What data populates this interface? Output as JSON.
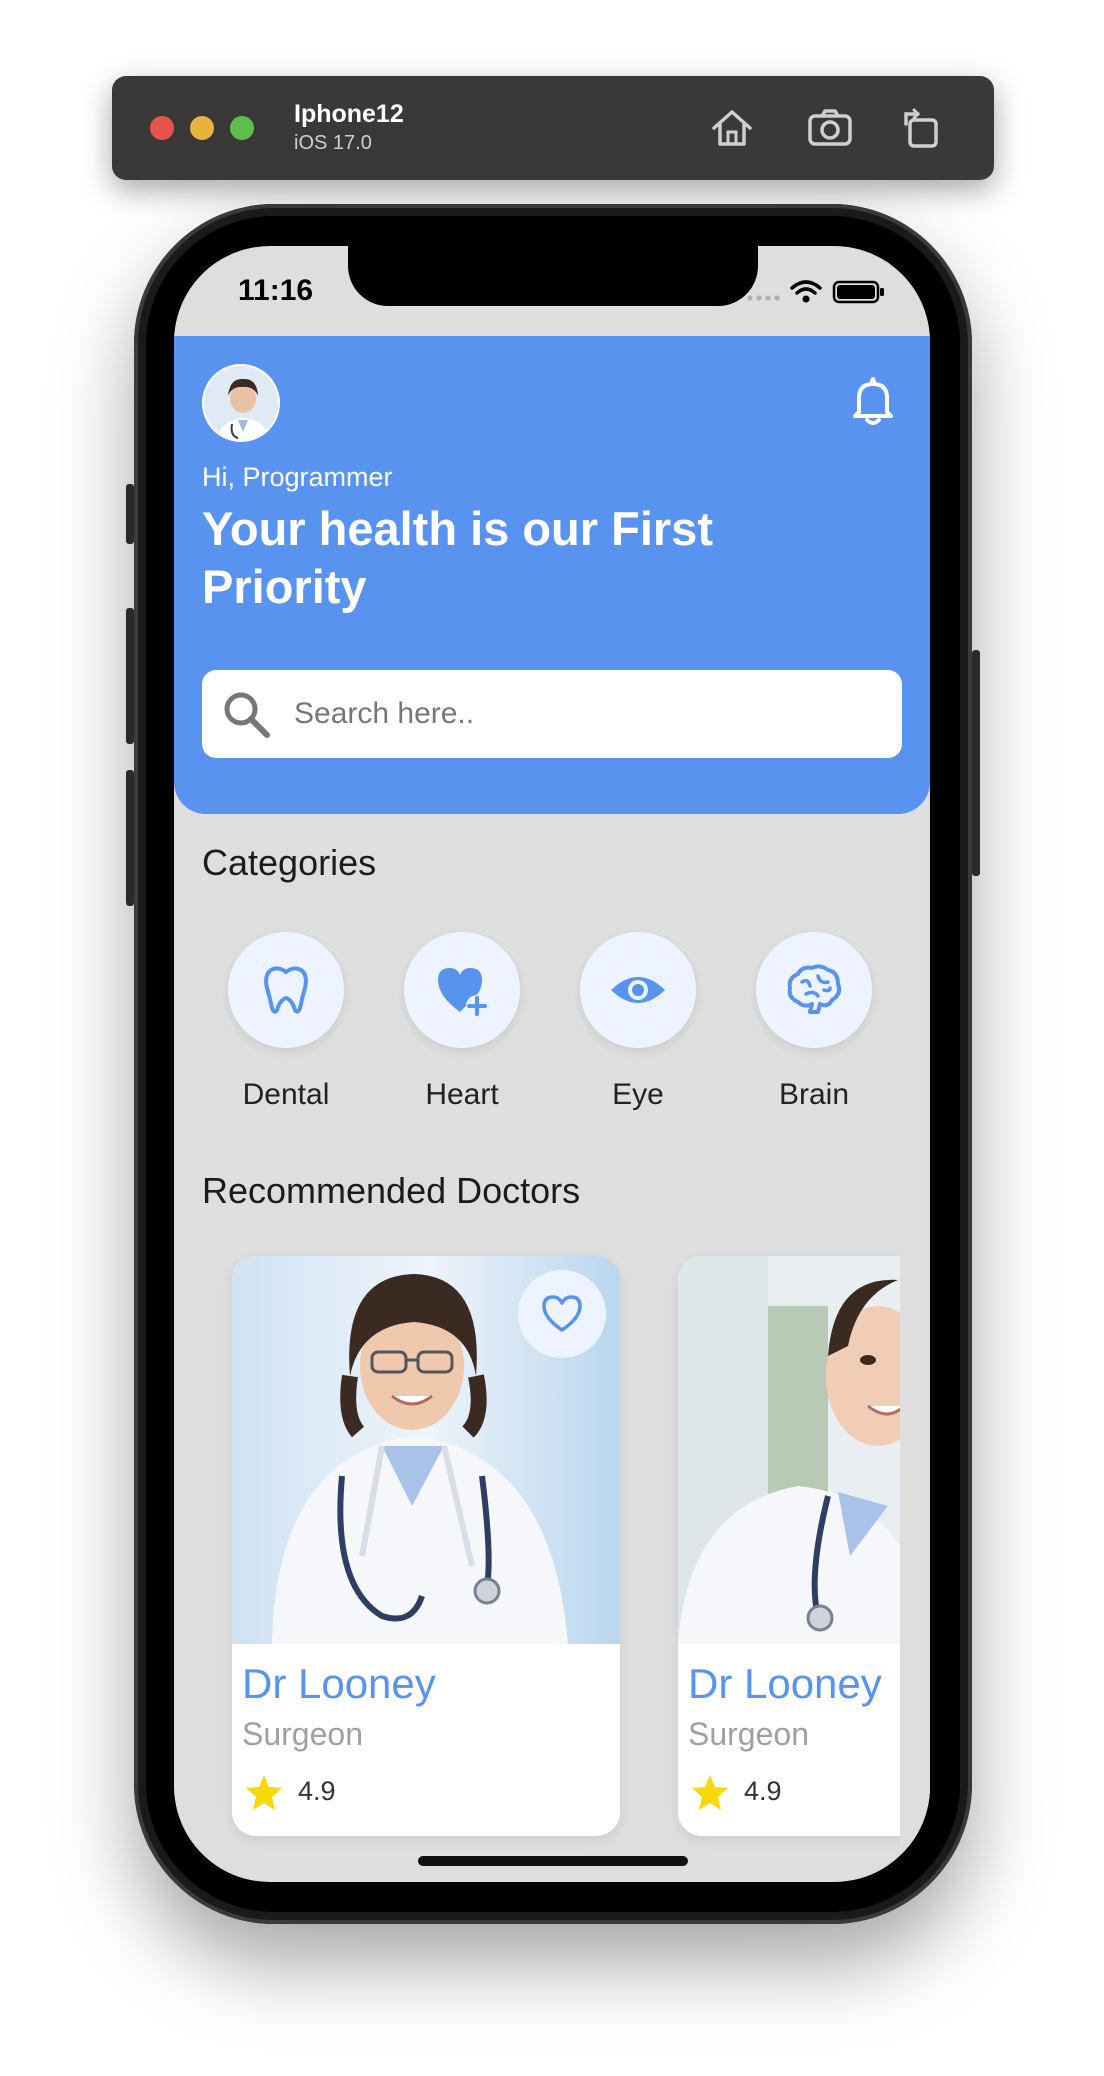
{
  "simulator": {
    "device": "Iphone12",
    "os": "iOS 17.0"
  },
  "status_bar": {
    "time": "11:16"
  },
  "header": {
    "greeting": "Hi, Programmer",
    "headline": "Your health is our First Priority"
  },
  "search": {
    "placeholder": "Search here.."
  },
  "categories": {
    "title": "Categories",
    "items": [
      {
        "label": "Dental",
        "icon": "tooth-icon"
      },
      {
        "label": "Heart",
        "icon": "heart-plus-icon"
      },
      {
        "label": "Eye",
        "icon": "eye-icon"
      },
      {
        "label": "Brain",
        "icon": "brain-icon"
      }
    ]
  },
  "recommended": {
    "title": "Recommended Doctors",
    "doctors": [
      {
        "name": "Dr Looney",
        "specialty": "Surgeon",
        "rating": "4.9"
      },
      {
        "name": "Dr Looney",
        "specialty": "Surgeon",
        "rating": "4.9"
      }
    ]
  },
  "colors": {
    "accent": "#5793ef",
    "background": "#dedede",
    "star": "#f5d90a"
  }
}
